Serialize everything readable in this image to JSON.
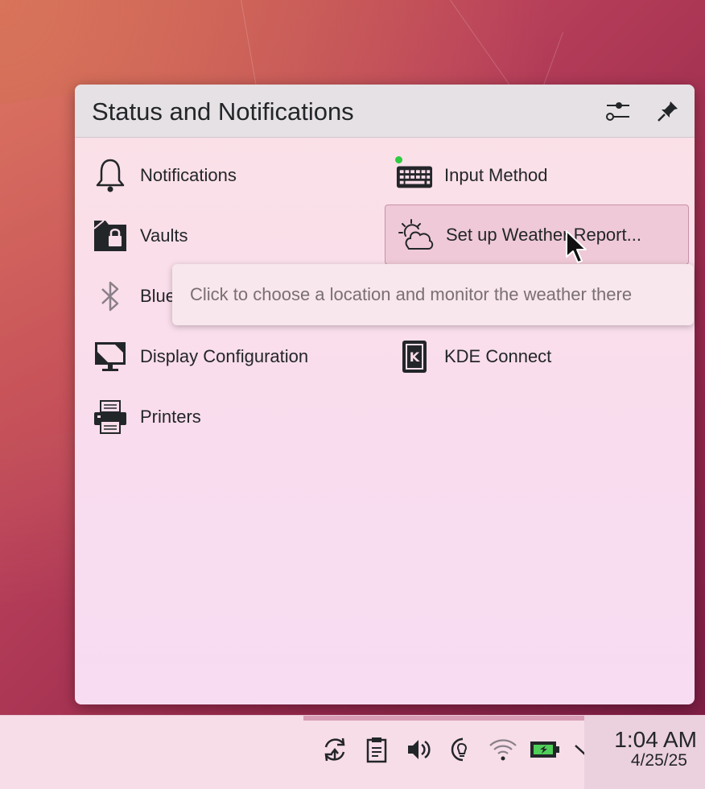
{
  "popup": {
    "title": "Status and Notifications",
    "header_buttons": {
      "configure_icon": "sliders-icon",
      "pin_icon": "pin-icon"
    }
  },
  "items": {
    "notifications": {
      "label": "Notifications",
      "icon": "bell-icon"
    },
    "input_method": {
      "label": "Input Method",
      "icon": "keyboard-icon",
      "status_dot_color": "#2ecc40"
    },
    "vaults": {
      "label": "Vaults",
      "icon": "vault-lock-icon"
    },
    "weather": {
      "label": "Set up Weather Report...",
      "icon": "weather-cloud-sun-icon"
    },
    "bluetooth": {
      "label": "Blue",
      "icon": "bluetooth-icon"
    },
    "display": {
      "label": "Display Configuration",
      "icon": "monitor-icon"
    },
    "kde_connect": {
      "label": "KDE Connect",
      "icon": "kde-connect-icon"
    },
    "printers": {
      "label": "Printers",
      "icon": "printer-icon"
    }
  },
  "tooltip": {
    "text": "Click to choose a location and monitor the weather there"
  },
  "taskbar": {
    "tray_icons": [
      "update-icon",
      "clipboard-icon",
      "volume-icon",
      "night-light-icon",
      "wifi-icon",
      "battery-icon",
      "expand-chevron-icon"
    ],
    "clock": {
      "time": "1:04 AM",
      "date": "4/25/25"
    }
  },
  "colors": {
    "popup_bg": "#fbe1e6",
    "header_bg": "#e6e1e4",
    "hover_bg": "#efc9d7",
    "hover_border": "#c792a8",
    "text": "#232629"
  }
}
